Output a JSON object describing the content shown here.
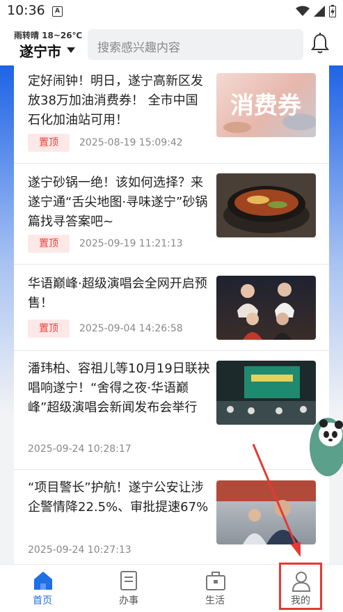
{
  "status_bar": {
    "time": "10:36",
    "notification_icon": "A"
  },
  "header": {
    "weather": "雨转晴 18~26℃",
    "city": "遂宁市",
    "search_placeholder": "搜索感兴趣内容"
  },
  "news": [
    {
      "title": "定好闹钟！明日，遂宁高新区发放38万加油消费券！ 全市中国石化加油站可用！",
      "pinned": true,
      "pin_label": "置顶",
      "date": "2025-08-19 15:09:42",
      "thumb_text": "消费券"
    },
    {
      "title": "遂宁砂锅一绝！该如何选择？来遂宁通“舌尖地图·寻味遂宁”砂锅篇找寻答案吧~",
      "pinned": true,
      "pin_label": "置顶",
      "date": "2025-09-19 11:21:13"
    },
    {
      "title": "华语巅峰·超级演唱会全网开启预售！",
      "pinned": true,
      "pin_label": "置顶",
      "date": "2025-09-04 14:26:58"
    },
    {
      "title": "潘玮柏、容祖儿等10月19日联袂唱响遂宁！“舍得之夜·华语巅峰”超级演唱会新闻发布会举行",
      "pinned": false,
      "date": "2025-09-24 10:28:17"
    },
    {
      "title": "“项目警长”护航！遂宁公安让涉企警情降22.5%、审批提速67%",
      "pinned": false,
      "date": "2025-09-24 10:27:13"
    }
  ],
  "tabs": [
    {
      "label": "首页",
      "icon": "home-icon",
      "active": true
    },
    {
      "label": "办事",
      "icon": "document-icon",
      "active": false
    },
    {
      "label": "生活",
      "icon": "briefcase-icon",
      "active": false
    },
    {
      "label": "我的",
      "icon": "user-icon",
      "active": false
    }
  ],
  "colors": {
    "accent": "#1f6fe5",
    "pin_bg": "#fde8e8",
    "pin_text": "#e8403a",
    "highlight": "#e53935"
  }
}
